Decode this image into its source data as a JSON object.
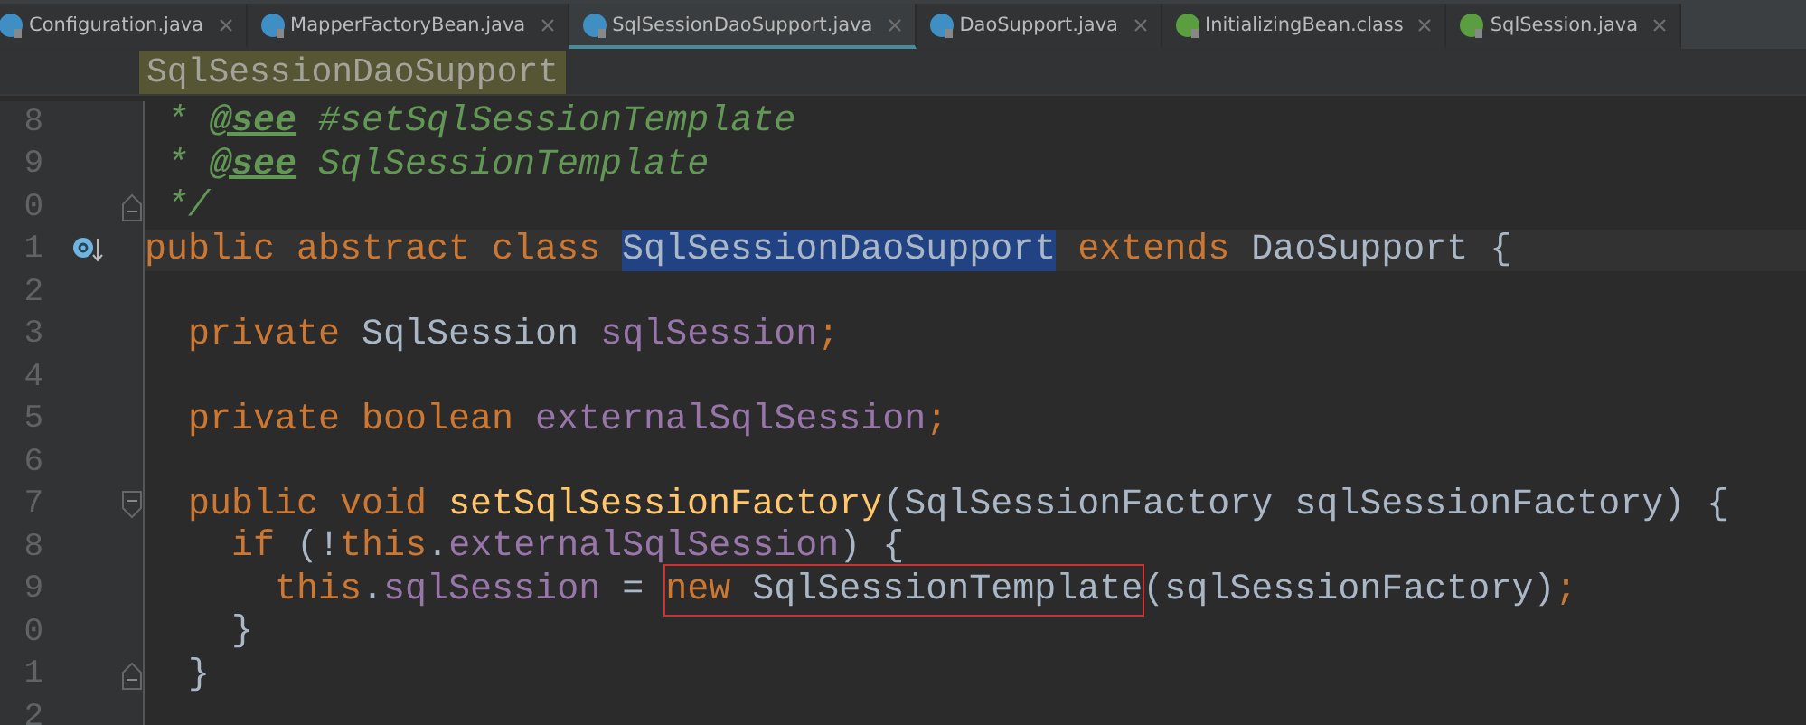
{
  "tabs": [
    {
      "label": "Configuration.java",
      "kind": "class",
      "selected": false
    },
    {
      "label": "MapperFactoryBean.java",
      "kind": "class",
      "selected": false
    },
    {
      "label": "SqlSessionDaoSupport.java",
      "kind": "class",
      "selected": true
    },
    {
      "label": "DaoSupport.java",
      "kind": "class",
      "selected": false
    },
    {
      "label": "InitializingBean.class",
      "kind": "interface",
      "selected": false
    },
    {
      "label": "SqlSession.java",
      "kind": "interface",
      "selected": false
    }
  ],
  "breadcrumb": "SqlSessionDaoSupport",
  "lines": [
    {
      "number": "8",
      "tokens": [
        {
          "kind": "comment",
          "text": " * "
        },
        {
          "kind": "tag",
          "text": "@see"
        },
        {
          "kind": "comment",
          "text": " #setSqlSessionTemplate"
        }
      ]
    },
    {
      "number": "9",
      "tokens": [
        {
          "kind": "comment",
          "text": " * "
        },
        {
          "kind": "tag",
          "text": "@see"
        },
        {
          "kind": "comment",
          "text": " SqlSessionTemplate"
        }
      ]
    },
    {
      "number": "0",
      "gutter_icon": {
        "kind": "fold_end"
      },
      "tokens": [
        {
          "kind": "comment",
          "text": " */"
        }
      ]
    },
    {
      "number": "1",
      "current": true,
      "gutter_icon": {
        "kind": "override"
      },
      "tokens": [
        {
          "kind": "keyword",
          "text": "public abstract class "
        },
        {
          "kind": "selection",
          "text": "SqlSessionDaoSupport"
        },
        {
          "kind": "keyword",
          "text": " extends "
        },
        {
          "kind": "plain",
          "text": "DaoSupport {"
        }
      ]
    },
    {
      "number": "2"
    },
    {
      "number": "3",
      "tokens": [
        {
          "kind": "keyword",
          "text": "  private "
        },
        {
          "kind": "plain",
          "text": "SqlSession "
        },
        {
          "kind": "field",
          "text": "sqlSession"
        },
        {
          "kind": "keyword",
          "text": ";"
        }
      ]
    },
    {
      "number": "4"
    },
    {
      "number": "5",
      "tokens": [
        {
          "kind": "keyword",
          "text": "  private boolean "
        },
        {
          "kind": "field",
          "text": "externalSqlSession"
        },
        {
          "kind": "keyword",
          "text": ";"
        }
      ]
    },
    {
      "number": "6"
    },
    {
      "number": "7",
      "gutter_icon": {
        "kind": "fold_start"
      },
      "tokens": [
        {
          "kind": "keyword",
          "text": "  public void "
        },
        {
          "kind": "method",
          "text": "setSqlSessionFactory"
        },
        {
          "kind": "plain",
          "text": "(SqlSessionFactory sqlSessionFactory) {"
        }
      ]
    },
    {
      "number": "8",
      "tokens": [
        {
          "kind": "keyword",
          "text": "    if "
        },
        {
          "kind": "plain",
          "text": "(!"
        },
        {
          "kind": "keyword",
          "text": "this"
        },
        {
          "kind": "plain",
          "text": "."
        },
        {
          "kind": "field",
          "text": "externalSqlSession"
        },
        {
          "kind": "plain",
          "text": ") {"
        }
      ]
    },
    {
      "number": "9",
      "tokens": [
        {
          "kind": "keyword",
          "text": "      this"
        },
        {
          "kind": "plain",
          "text": "."
        },
        {
          "kind": "field",
          "text": "sqlSession"
        },
        {
          "kind": "plain",
          "text": " = "
        },
        {
          "kind": "boxed",
          "tokens": [
            {
              "kind": "keyword",
              "text": "new "
            },
            {
              "kind": "plain",
              "text": "SqlSessionTemplate"
            }
          ]
        },
        {
          "kind": "plain",
          "text": "(sqlSessionFactory)"
        },
        {
          "kind": "keyword",
          "text": ";"
        }
      ]
    },
    {
      "number": "0",
      "tokens": [
        {
          "kind": "plain",
          "text": "    }"
        }
      ]
    },
    {
      "number": "1",
      "gutter_icon": {
        "kind": "fold_end"
      },
      "tokens": [
        {
          "kind": "plain",
          "text": "  }"
        }
      ]
    },
    {
      "number": "2"
    }
  ]
}
